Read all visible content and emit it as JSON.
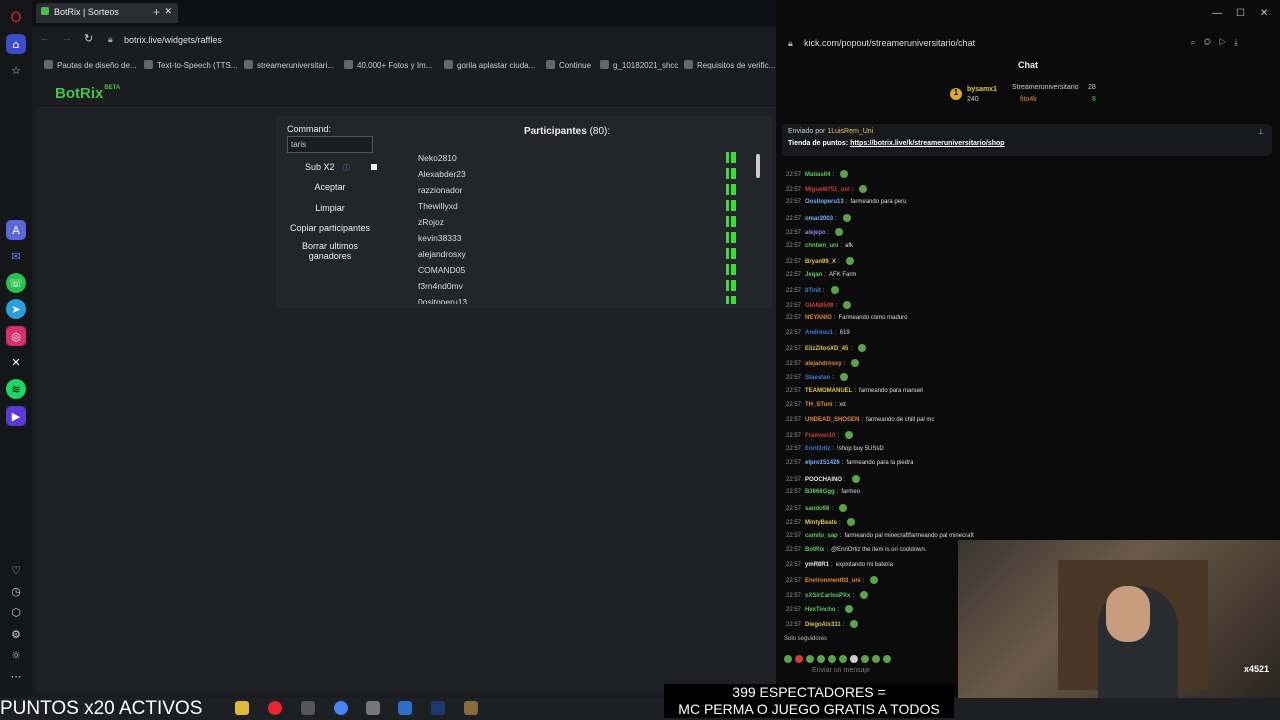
{
  "browser": {
    "tab_title": "BotRix | Sorteos",
    "url": "botrix.live/widgets/raffles",
    "bookmarks": [
      "Pautas de diseño de...",
      "Text-to-Speech (TTS...",
      "streameruniversitari...",
      "40.000+ Fotos y Im...",
      "gorila aplastar ciuda...",
      "Continue",
      "g_10182021_shcc",
      "Requisitos de verific..."
    ]
  },
  "botrix": {
    "logo": "BotRix",
    "logo_badge": "BETA",
    "command_label": "Command:",
    "command_value": "taris",
    "sub_label": "Sub X2",
    "buttons": [
      "Aceptar",
      "Limpiar",
      "Copiar participantes",
      "Borrar ultimos ganadores"
    ],
    "participants_title": "Participantes",
    "participants_count": "(80):",
    "participants": [
      "Neko2810",
      "Alexabder23",
      "razzionador",
      "Thewillyxd",
      "zRojoz",
      "kevin38333",
      "alejandrosxy",
      "COMAND05",
      "f3rn4nd0mv",
      "0ositoperu13"
    ]
  },
  "chat": {
    "url": "kick.com/popout/streameruniversitario/chat",
    "header": "Chat",
    "leaderboard": [
      "bysamx1",
      "240",
      "Streameruniversitario",
      "28",
      "fito4k",
      "8"
    ],
    "pinned_by": "Enviado por",
    "pinned_user": "1LuisRem_Uni",
    "pinned_text": "Tienda de puntos:",
    "pinned_link": "https://botrix.live/k/streameruniversitario/shop",
    "messages": [
      {
        "t": "22:57",
        "u": "Matias04",
        "c": "#5ec95e",
        "m": ""
      },
      {
        "t": "22:57",
        "u": "Miguel8751_uni",
        "c": "#d23b3b",
        "m": ""
      },
      {
        "t": "22:57",
        "u": "Oositoperu13",
        "c": "#7ab0ff",
        "m": "farmeando para peru"
      },
      {
        "t": "22:57",
        "u": "omar2003",
        "c": "#7ab0ff",
        "m": ""
      },
      {
        "t": "22:57",
        "u": "alejepo",
        "c": "#9b7ae8",
        "m": ""
      },
      {
        "t": "22:57",
        "u": "chntwn_uni",
        "c": "#5ec95e",
        "m": "afk"
      },
      {
        "t": "22:57",
        "u": "Bryan98_X",
        "c": "#e0c64a",
        "m": ""
      },
      {
        "t": "22:57",
        "u": "Jeqan",
        "c": "#5ec95e",
        "m": "AFK Farm"
      },
      {
        "t": "22:57",
        "u": "8Tinit",
        "c": "#3a7bd5",
        "m": ""
      },
      {
        "t": "22:57",
        "u": "GIAN8509",
        "c": "#d23b3b",
        "m": ""
      },
      {
        "t": "22:57",
        "u": "NEYANIO",
        "c": "#e08a3a",
        "m": "Farmeando como maduro"
      },
      {
        "t": "22:57",
        "u": "Andreuu1",
        "c": "#3a7bd5",
        "m": "619"
      },
      {
        "t": "22:57",
        "u": "ElizZitooXD_45",
        "c": "#e0c64a",
        "m": ""
      },
      {
        "t": "22:57",
        "u": "alejandrosxy",
        "c": "#e08a3a",
        "m": ""
      },
      {
        "t": "22:57",
        "u": "Staestan",
        "c": "#3a7bd5",
        "m": ""
      },
      {
        "t": "22:57",
        "u": "TEAMOMANUEL",
        "c": "#e0c64a",
        "m": "farmeando para manuel"
      },
      {
        "t": "22:57",
        "u": "TH_STuni",
        "c": "#e08a3a",
        "m": "xd"
      },
      {
        "t": "22:57",
        "u": "UNDEAD_SHOSEN",
        "c": "#e08a3a",
        "m": "farmeando de chill pal mc"
      },
      {
        "t": "22:57",
        "u": "Framver10",
        "c": "#d23b3b",
        "m": ""
      },
      {
        "t": "22:57",
        "u": "EnriOrtiz",
        "c": "#3a7bd5",
        "m": "!shop buy 5USsD"
      },
      {
        "t": "22:57",
        "u": "elpro151426",
        "c": "#7ab0ff",
        "m": "farmeando para la piedra"
      },
      {
        "t": "22:57",
        "u": "POOCHAINO",
        "c": "#e8e8e8",
        "m": ""
      },
      {
        "t": "22:57",
        "u": "B3666Ggg",
        "c": "#5ec95e",
        "m": "farmeo"
      },
      {
        "t": "22:57",
        "u": "sando98",
        "c": "#5ec95e",
        "m": ""
      },
      {
        "t": "22:57",
        "u": "MintyBeats",
        "c": "#e0c64a",
        "m": ""
      },
      {
        "t": "22:57",
        "u": "camilo_sap",
        "c": "#5ec95e",
        "m": "farmeando pal minecraftfarmeando pal minecraft"
      },
      {
        "t": "22:57",
        "u": "BotRix",
        "c": "#5ec95e",
        "m": "@EnriOrtiz the item is on cooldown."
      },
      {
        "t": "22:57",
        "u": "ymR8R1",
        "c": "#e8e8e8",
        "m": "explotando mi bateria"
      },
      {
        "t": "22:57",
        "u": "Environment03_uni",
        "c": "#e08a3a",
        "m": ""
      },
      {
        "t": "22:57",
        "u": "xXSirCarlosPXx",
        "c": "#5ec95e",
        "m": ""
      },
      {
        "t": "22:57",
        "u": "HexTincho",
        "c": "#5ec95e",
        "m": ""
      },
      {
        "t": "22:57",
        "u": "DiegoAlx311",
        "c": "#e0c64a",
        "m": ""
      }
    ],
    "followers_only": "Solo seguidores",
    "input_placeholder": "Enviar un mensaje"
  },
  "overlay": {
    "puntos": "PUNTOS x20 ACTIVOS",
    "espectadores_line1": "399 ESPECTADORES =",
    "espectadores_line2": "MC PERMA O JUEGO GRATIS A TODOS",
    "cam_badge": "x4521"
  }
}
